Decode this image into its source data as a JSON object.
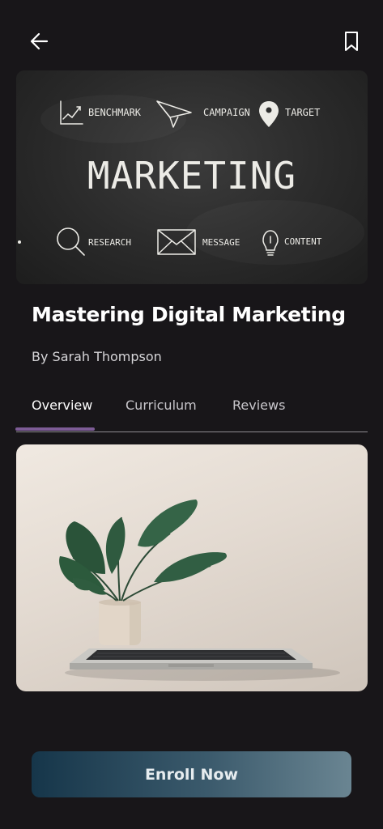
{
  "header": {
    "back_icon": "arrow-left-icon",
    "bookmark_icon": "bookmark-icon"
  },
  "hero": {
    "title": "MARKETING",
    "items": [
      {
        "label": "BENCHMARK",
        "icon": "chart-icon"
      },
      {
        "label": "CAMPAIGN",
        "icon": "paper-plane-icon"
      },
      {
        "label": "TARGET",
        "icon": "location-pin-icon"
      },
      {
        "label": "RESEARCH",
        "icon": "magnifier-icon"
      },
      {
        "label": "MESSAGE",
        "icon": "envelope-icon"
      },
      {
        "label": "CONTENT",
        "icon": "lightbulb-icon"
      }
    ]
  },
  "course": {
    "title": "Mastering Digital Marketing",
    "author": "By Sarah Thompson"
  },
  "tabs": [
    {
      "label": "Overview",
      "active": true
    },
    {
      "label": "Curriculum",
      "active": false
    },
    {
      "label": "Reviews",
      "active": false
    }
  ],
  "colors": {
    "background": "#181619",
    "tab_indicator": "#7d5c96",
    "button_start": "#16364a",
    "button_end": "#6a8592"
  },
  "cta": {
    "label": "Enroll Now"
  }
}
